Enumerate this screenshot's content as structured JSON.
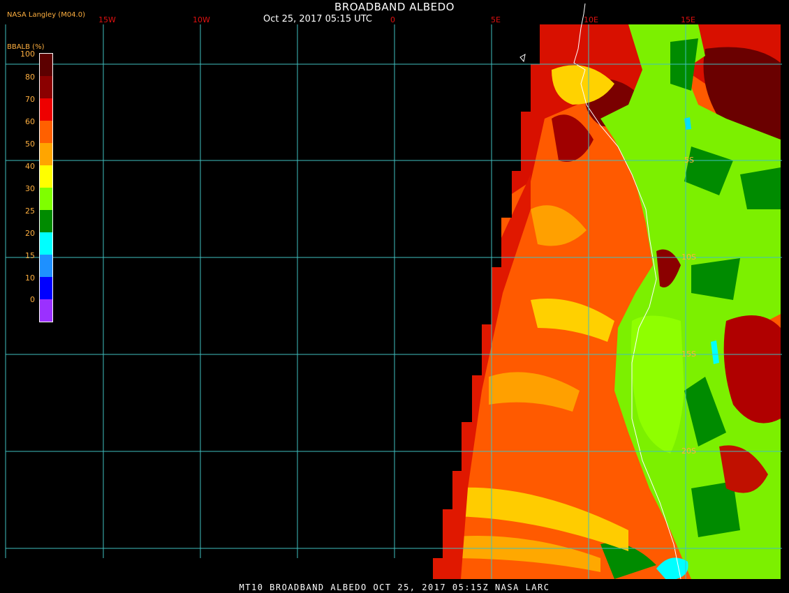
{
  "header": {
    "title": "BROADBAND ALBEDO",
    "subtitle": "Oct 25, 2017 05:15 UTC",
    "producer": "NASA Langley (M04.0)"
  },
  "footer": {
    "text": "MT10  BROADBAND ALBEDO   OCT 25, 2017 05:15Z   NASA LARC"
  },
  "legend": {
    "title": "BBALB (%)",
    "ticks": [
      "100",
      "80",
      "70",
      "60",
      "50",
      "40",
      "30",
      "25",
      "20",
      "15",
      "10",
      "0"
    ],
    "colors": [
      "#5c0000",
      "#8b0000",
      "#ee0000",
      "#ff6000",
      "#ffa500",
      "#ffff00",
      "#7fff00",
      "#008b00",
      "#00ffff",
      "#1e90ff",
      "#0000ff",
      "#9b30ff"
    ]
  },
  "grid": {
    "lon_labels": [
      "15W",
      "10W",
      "0",
      "5E",
      "10E",
      "15E"
    ],
    "lat_labels": [
      "5S",
      "10S",
      "15S",
      "20S"
    ]
  },
  "colors": {
    "grid_line": "#40c0c0",
    "coast": "#ffffff",
    "background": "#000000"
  }
}
